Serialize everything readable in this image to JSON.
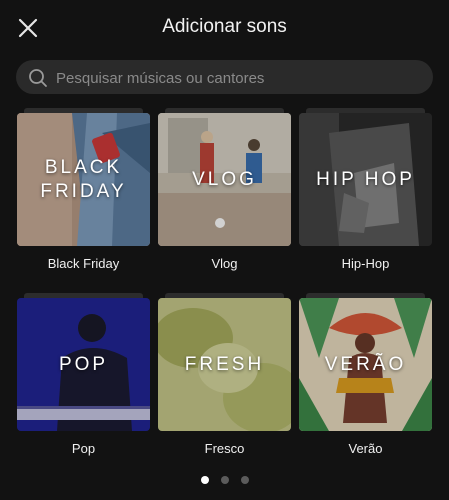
{
  "header": {
    "title": "Adicionar sons",
    "close_icon": "close-icon"
  },
  "search": {
    "placeholder": "Pesquisar músicas ou cantores",
    "icon": "search-icon"
  },
  "categories": [
    {
      "overlay": "BLACK\nFRIDAY",
      "label": "Black Friday"
    },
    {
      "overlay": "VLOG",
      "label": "Vlog"
    },
    {
      "overlay": "HIP HOP",
      "label": "Hip-Hop"
    },
    {
      "overlay": "POP",
      "label": "Pop"
    },
    {
      "overlay": "FRESH",
      "label": "Fresco"
    },
    {
      "overlay": "VERÃO",
      "label": "Verão"
    }
  ],
  "pagination": {
    "pages": 3,
    "current": 1
  },
  "colors": {
    "background": "#121212",
    "search_bg": "#2a2a2a",
    "dot_inactive": "#5b5b5b",
    "dot_active": "#ffffff"
  }
}
